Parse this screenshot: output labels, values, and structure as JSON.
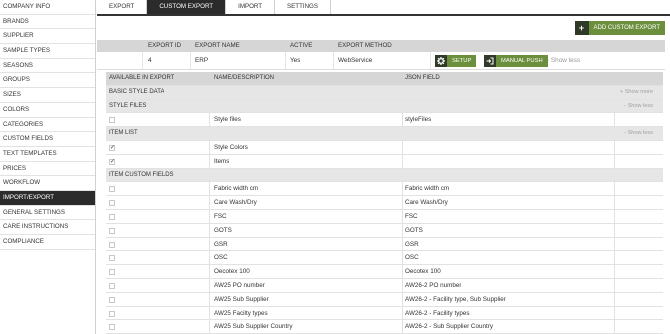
{
  "sidebar": {
    "items": [
      {
        "label": "COMPANY INFO"
      },
      {
        "label": "BRANDS"
      },
      {
        "label": "SUPPLIER"
      },
      {
        "label": "SAMPLE TYPES"
      },
      {
        "label": "SEASONS"
      },
      {
        "label": "GROUPS"
      },
      {
        "label": "SIZES"
      },
      {
        "label": "COLORS"
      },
      {
        "label": "CATEGORIES"
      },
      {
        "label": "CUSTOM FIELDS"
      },
      {
        "label": "TEXT TEMPLATES"
      },
      {
        "label": "PRICES"
      },
      {
        "label": "WORKFLOW"
      },
      {
        "label": "IMPORT/EXPORT"
      },
      {
        "label": "GENERAL SETTINGS"
      },
      {
        "label": "CARE INSTRUCTIONS"
      },
      {
        "label": "COMPLIANCE"
      }
    ],
    "active_index": 13
  },
  "tabs": [
    {
      "label": "EXPORT"
    },
    {
      "label": "CUSTOM EXPORT"
    },
    {
      "label": "IMPORT"
    },
    {
      "label": "SETTINGS"
    }
  ],
  "add_button": {
    "icon": "plus-icon",
    "label": "ADD CUSTOM EXPORT"
  },
  "exports_table": {
    "headers": {
      "export_id": "EXPORT ID",
      "export_name": "EXPORT NAME",
      "active": "ACTIVE",
      "export_method": "EXPORT METHOD"
    },
    "row": {
      "export_id": "4",
      "export_name": "ERP",
      "active": "Yes",
      "export_method": "WebService",
      "setup_label": "SETUP",
      "setup_icon": "gear-icon",
      "push_label": "MANUAL PUSH",
      "push_icon": "sign-in-icon",
      "show_less": "- Show less"
    }
  },
  "fields_table": {
    "headers": {
      "available": "AVAILABLE IN EXPORT",
      "name": "NAME/DESCRIPTION",
      "json": "JSON FIELD"
    },
    "rows": [
      {
        "type": "group",
        "label": "BASIC STYLE DATA",
        "toggle": "+ Show more"
      },
      {
        "type": "group",
        "label": "STYLE FILES",
        "toggle": "- Show less"
      },
      {
        "type": "item",
        "checked": false,
        "name": "Style files",
        "json": "styleFiles"
      },
      {
        "type": "group",
        "label": "ITEM LIST",
        "toggle": "- Show less"
      },
      {
        "type": "item",
        "checked": true,
        "name": "Style Colors",
        "json": ""
      },
      {
        "type": "item",
        "checked": true,
        "name": "Items",
        "json": ""
      },
      {
        "type": "group",
        "label": "ITEM CUSTOM FIELDS",
        "toggle": ""
      },
      {
        "type": "item",
        "checked": false,
        "name": "Fabric width cm",
        "json": "Fabric width cm"
      },
      {
        "type": "item",
        "checked": false,
        "name": "Care Wash/Dry",
        "json": "Care Wash/Dry"
      },
      {
        "type": "item",
        "checked": false,
        "name": "FSC",
        "json": "FSC"
      },
      {
        "type": "item",
        "checked": false,
        "name": "GOTS",
        "json": "GOTS"
      },
      {
        "type": "item",
        "checked": false,
        "name": "GSR",
        "json": "GSR"
      },
      {
        "type": "item",
        "checked": false,
        "name": "OSC",
        "json": "OSC"
      },
      {
        "type": "item",
        "checked": false,
        "name": "Oecotex 100",
        "json": "Oecotex 100"
      },
      {
        "type": "item",
        "checked": false,
        "name": "AW25 PO number",
        "json": "AW26-2 PO number"
      },
      {
        "type": "item",
        "checked": false,
        "name": "AW25 Sub Supplier",
        "json": "AW26-2 - Facility type, Sub Supplier"
      },
      {
        "type": "item",
        "checked": false,
        "name": "AW25 Facilty types",
        "json": "AW26-2 - Facility types"
      },
      {
        "type": "item",
        "checked": false,
        "name": "AW25 Sub Supplier Country",
        "json": "AW26-2 - Sub Supplier Country"
      }
    ]
  },
  "colors": {
    "accent_green": "#6b8f3d",
    "dark": "#2b2b2b"
  }
}
